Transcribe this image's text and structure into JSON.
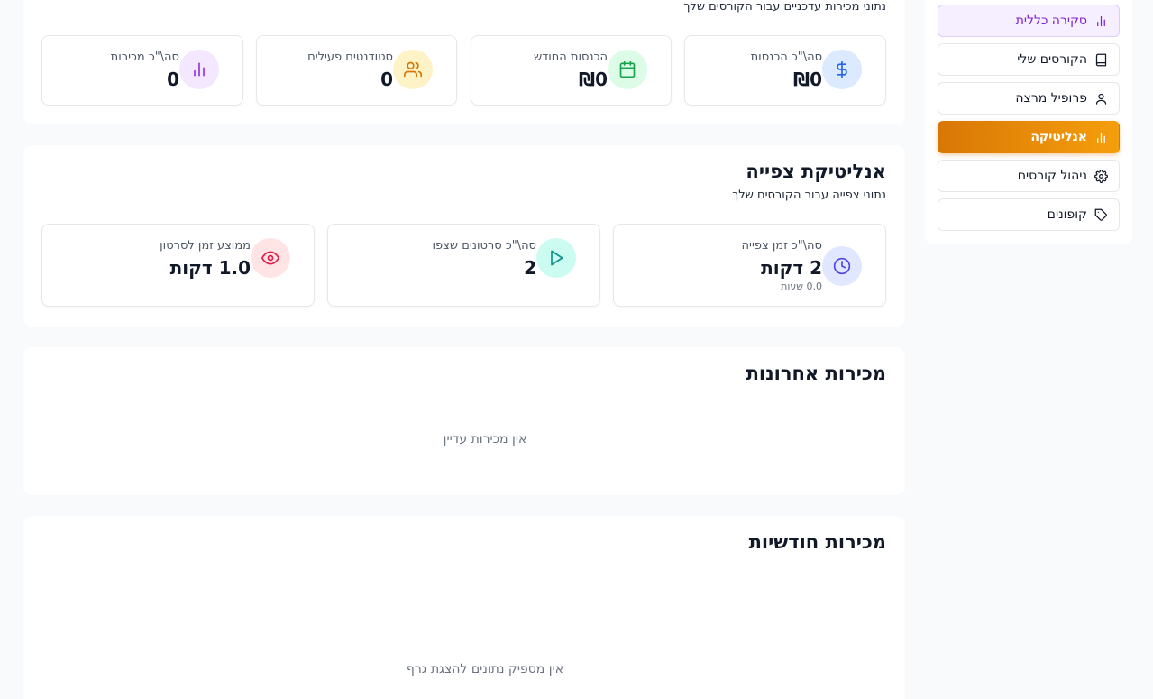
{
  "sidebar": {
    "items": [
      {
        "label": "סקירה כללית",
        "icon": "bar-chart-icon"
      },
      {
        "label": "הקורסים שלי",
        "icon": "book-icon"
      },
      {
        "label": "פרופיל מרצה",
        "icon": "user-icon"
      },
      {
        "label": "אנליטיקה",
        "icon": "bar-chart-icon"
      },
      {
        "label": "ניהול קורסים",
        "icon": "gear-icon"
      },
      {
        "label": "קופונים",
        "icon": "tag-icon"
      }
    ]
  },
  "sales": {
    "subtitle": "נתוני מכירות עדכניים עבור הקורסים שלך",
    "cards": [
      {
        "label": "סה\\\"כ הכנסות",
        "value": "₪0",
        "icon": "dollar-icon",
        "color": "#2563eb",
        "bg": "#dbeafe"
      },
      {
        "label": "הכנסות החודש",
        "value": "₪0",
        "icon": "calendar-icon",
        "color": "#16a34a",
        "bg": "#dcfce7"
      },
      {
        "label": "סטודנטים פעילים",
        "value": "0",
        "icon": "users-icon",
        "color": "#d97706",
        "bg": "#fef3c7"
      },
      {
        "label": "סה\\\"כ מכירות",
        "value": "0",
        "icon": "bar-chart-icon",
        "color": "#9333ea",
        "bg": "#f3e8ff"
      }
    ]
  },
  "viewing": {
    "title": "אנליטיקת צפייה",
    "subtitle": "נתוני צפייה עבור הקורסים שלך",
    "cards": [
      {
        "label": "סה\\\"כ זמן צפייה",
        "value": "2 דקות",
        "sub": "0.0 שעות",
        "icon": "clock-icon",
        "color": "#4f46e5",
        "bg": "#e0e7ff"
      },
      {
        "label": "סה\\\"כ סרטונים שצפו",
        "value": "2",
        "sub": "",
        "icon": "play-icon",
        "color": "#0d9488",
        "bg": "#ccfbf1"
      },
      {
        "label": "ממוצע זמן לסרטון",
        "value": "1.0 דקות",
        "sub": "",
        "icon": "eye-icon",
        "color": "#e11d48",
        "bg": "#ffe4e6"
      }
    ]
  },
  "recent_sales": {
    "title": "מכירות אחרונות",
    "empty": "אין מכירות עדיין"
  },
  "monthly_sales": {
    "title": "מכירות חודשיות",
    "empty": "אין מספיק נתונים להצגת גרף"
  }
}
